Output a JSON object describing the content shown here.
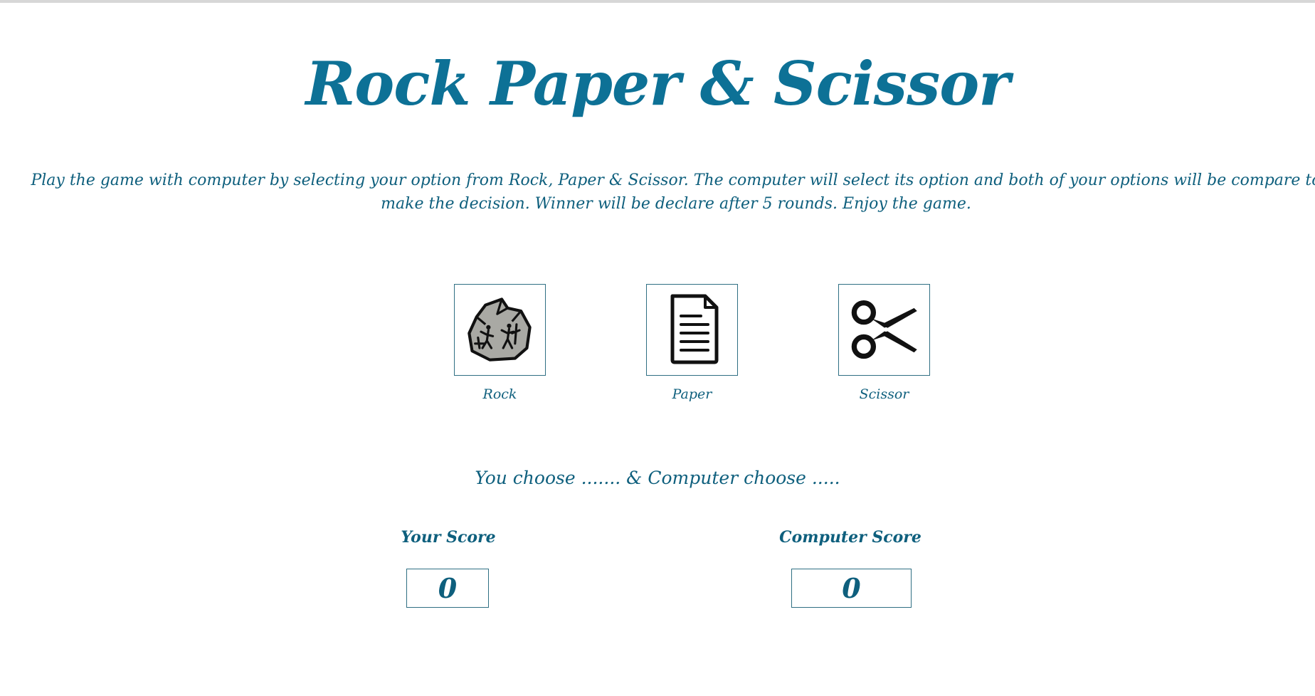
{
  "header": {
    "title": "Rock Paper & Scissor"
  },
  "intro": {
    "description": "Play the game with computer by selecting your option from Rock, Paper & Scissor. The computer will select its option and both of your options will be compare to make the decision. Winner will be declare after 5 rounds. Enjoy the game."
  },
  "choices": [
    {
      "label": "Rock",
      "icon": "rock-icon"
    },
    {
      "label": "Paper",
      "icon": "paper-icon"
    },
    {
      "label": "Scissor",
      "icon": "scissor-icon"
    }
  ],
  "status": {
    "text": "You choose ....... & Computer choose ....."
  },
  "scores": {
    "player_label": "Your Score",
    "player_value": "0",
    "computer_label": "Computer Score",
    "computer_value": "0"
  },
  "colors": {
    "title": "#0d7196",
    "text": "#0e5f7d",
    "border": "#2f6f83",
    "rock_fill": "#a9a9a4"
  }
}
